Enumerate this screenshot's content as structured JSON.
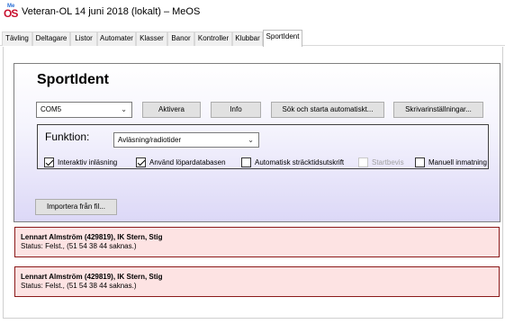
{
  "window": {
    "title": "Veteran-OL 14 juni 2018 (lokalt) – MeOS"
  },
  "tabs": [
    {
      "label": "Tävling"
    },
    {
      "label": "Deltagare"
    },
    {
      "label": "Listor"
    },
    {
      "label": "Automater"
    },
    {
      "label": "Klasser"
    },
    {
      "label": "Banor"
    },
    {
      "label": "Kontroller"
    },
    {
      "label": "Klubbar"
    },
    {
      "label": "SportIdent",
      "active": true
    }
  ],
  "sportident": {
    "title": "SportIdent",
    "port_value": "COM5",
    "buttons": {
      "activate": "Aktivera",
      "info": "Info",
      "autosearch": "Sök och starta automatiskt...",
      "printer": "Skrivarinställningar...",
      "import": "Importera från fil..."
    },
    "function_label": "Funktion:",
    "function_value": "Avläsning/radiotider",
    "options": [
      {
        "label": "Interaktiv inläsning",
        "checked": true,
        "enabled": true
      },
      {
        "label": "Använd löpardatabasen",
        "checked": true,
        "enabled": true
      },
      {
        "label": "Automatisk sträcktidsutskrift",
        "checked": false,
        "enabled": true
      },
      {
        "label": "Startbevis",
        "checked": false,
        "enabled": false
      },
      {
        "label": "Manuell inmatning",
        "checked": false,
        "enabled": true
      }
    ]
  },
  "messages": [
    {
      "name": "Lennart Almström (429819),  IK Stern,  Stig",
      "status": "Status: Felst., (51 54 38 44  saknas.)"
    },
    {
      "name": "Lennart Almström (429819),  IK Stern,  Stig",
      "status": "Status: Felst., (51 54 38 44  saknas.)"
    }
  ],
  "colors": {
    "panel_gradient_end": "#dcd8f7",
    "message_bg": "#fde3e3",
    "message_border": "#8b1a1a"
  }
}
